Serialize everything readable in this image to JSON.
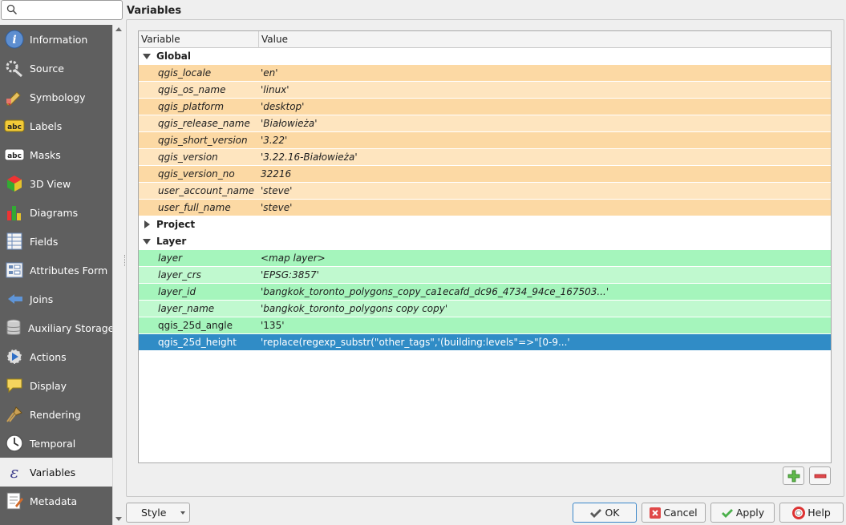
{
  "search": {
    "placeholder": ""
  },
  "sidebar": {
    "items": [
      {
        "label": "Information",
        "icon": "information-icon"
      },
      {
        "label": "Source",
        "icon": "source-icon"
      },
      {
        "label": "Symbology",
        "icon": "symbology-icon"
      },
      {
        "label": "Labels",
        "icon": "labels-icon"
      },
      {
        "label": "Masks",
        "icon": "masks-icon"
      },
      {
        "label": "3D View",
        "icon": "3d-view-icon"
      },
      {
        "label": "Diagrams",
        "icon": "diagrams-icon"
      },
      {
        "label": "Fields",
        "icon": "fields-icon"
      },
      {
        "label": "Attributes Form",
        "icon": "attributes-form-icon"
      },
      {
        "label": "Joins",
        "icon": "joins-icon"
      },
      {
        "label": "Auxiliary Storage",
        "icon": "auxiliary-storage-icon"
      },
      {
        "label": "Actions",
        "icon": "actions-icon"
      },
      {
        "label": "Display",
        "icon": "display-icon"
      },
      {
        "label": "Rendering",
        "icon": "rendering-icon"
      },
      {
        "label": "Temporal",
        "icon": "temporal-icon"
      },
      {
        "label": "Variables",
        "icon": "variables-icon",
        "active": true
      },
      {
        "label": "Metadata",
        "icon": "metadata-icon"
      }
    ]
  },
  "page": {
    "title": "Variables"
  },
  "table": {
    "headers": {
      "variable": "Variable",
      "value": "Value"
    },
    "groups": [
      {
        "name": "Global",
        "expanded": true,
        "rows": [
          {
            "variable": "qgis_locale",
            "value": "'en'"
          },
          {
            "variable": "qgis_os_name",
            "value": "'linux'"
          },
          {
            "variable": "qgis_platform",
            "value": "'desktop'"
          },
          {
            "variable": "qgis_release_name",
            "value": "'Białowieża'"
          },
          {
            "variable": "qgis_short_version",
            "value": "'3.22'"
          },
          {
            "variable": "qgis_version",
            "value": "'3.22.16-Białowieża'"
          },
          {
            "variable": "qgis_version_no",
            "value": "32216"
          },
          {
            "variable": "user_account_name",
            "value": "'steve'"
          },
          {
            "variable": "user_full_name",
            "value": "'steve'"
          }
        ]
      },
      {
        "name": "Project",
        "expanded": false,
        "rows": []
      },
      {
        "name": "Layer",
        "expanded": true,
        "rows": [
          {
            "variable": "layer",
            "value": "<map layer>"
          },
          {
            "variable": "layer_crs",
            "value": "'EPSG:3857'"
          },
          {
            "variable": "layer_id",
            "value": "'bangkok_toronto_polygons_copy_ca1ecafd_dc96_4734_94ce_167503...'"
          },
          {
            "variable": "layer_name",
            "value": "'bangkok_toronto_polygons copy copy'"
          },
          {
            "variable": "qgis_25d_angle",
            "value": "'135'",
            "editable": true
          },
          {
            "variable": "qgis_25d_height",
            "value": "'replace(regexp_substr(\"other_tags\",'(building:levels\"=>\"[0-9...'",
            "editable": true,
            "selected": true
          }
        ]
      }
    ]
  },
  "colors": {
    "global_row_a": "#fcd9a4",
    "global_row_b": "#fee5bf",
    "layer_row_a": "#a5f5bc",
    "layer_row_b": "#c0f9cf",
    "selected": "#308cc6",
    "sidebar_bg": "#5f5f5f"
  },
  "buttons": {
    "add_variable": "add-variable-button",
    "remove_variable": "remove-variable-button",
    "style": "Style",
    "ok": "OK",
    "cancel": "Cancel",
    "apply": "Apply",
    "help": "Help"
  }
}
